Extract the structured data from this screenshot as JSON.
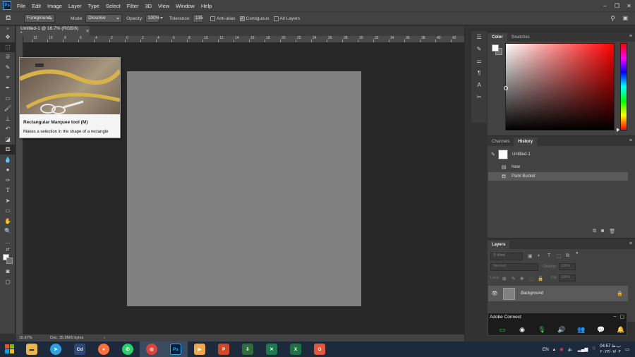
{
  "app": {
    "logo": "Ps"
  },
  "menu": [
    "File",
    "Edit",
    "Image",
    "Layer",
    "Type",
    "Select",
    "Filter",
    "3D",
    "View",
    "Window",
    "Help"
  ],
  "window_controls": [
    "–",
    "❐",
    "✕"
  ],
  "options": {
    "fill_source": "Foreground",
    "mode_label": "Mode:",
    "mode_value": "Dissolve",
    "opacity_label": "Opacity:",
    "opacity_value": "100%",
    "tolerance_label": "Tolerance:",
    "tolerance_value": "135",
    "antialias_label": "Anti-alias",
    "antialias_checked": false,
    "contiguous_label": "Contiguous",
    "contiguous_checked": true,
    "all_layers_label": "All Layers",
    "all_layers_checked": false
  },
  "document": {
    "tab_title": "Untitled-1 @ 16.7% (RGB/8) *",
    "canvas_color": "#808080",
    "ruler_labels": [
      "12",
      "10",
      "8",
      "6",
      "4",
      "2",
      "0",
      "2",
      "4",
      "6",
      "8",
      "10",
      "12",
      "14",
      "16",
      "18",
      "20",
      "22",
      "24",
      "26",
      "28",
      "30",
      "32",
      "34",
      "36",
      "38",
      "40",
      "42"
    ]
  },
  "status": {
    "zoom": "16.67%",
    "doc": "Doc: 35.9M/0 bytes",
    "arrow": "›"
  },
  "tooltip": {
    "title": "Rectangular Marquee tool (M)",
    "description": "Makes a selection in the shape of a rectangle"
  },
  "panels": {
    "color_tabs": [
      "Color",
      "Swatches"
    ],
    "history_tabs": [
      "Channels",
      "History"
    ],
    "history_items": [
      {
        "label": "Untitled-1",
        "icon": "snapshot-thumb"
      },
      {
        "label": "New",
        "icon": "new-doc-icon"
      },
      {
        "label": "Paint Bucket",
        "icon": "paint-bucket-icon"
      }
    ],
    "layers_tab": "Layers",
    "layers_filter": "Kind",
    "blend_mode": "Normal",
    "opacity_label": "Opacity:",
    "opacity_value": "100%",
    "lock_label": "Lock:",
    "fill_label": "Fill:",
    "fill_value": "100%",
    "layer_name": "Background"
  },
  "adobe_connect": {
    "title": "Adobe Connect"
  },
  "taskbar": {
    "language": "EN",
    "time": "04:57 ب.ظ",
    "date": "۲۰۲۳/۰۷/۰۳"
  },
  "colors": {
    "accent": "#31a8ff",
    "canvas_bg": "#282828",
    "panel_bg": "#424242"
  }
}
